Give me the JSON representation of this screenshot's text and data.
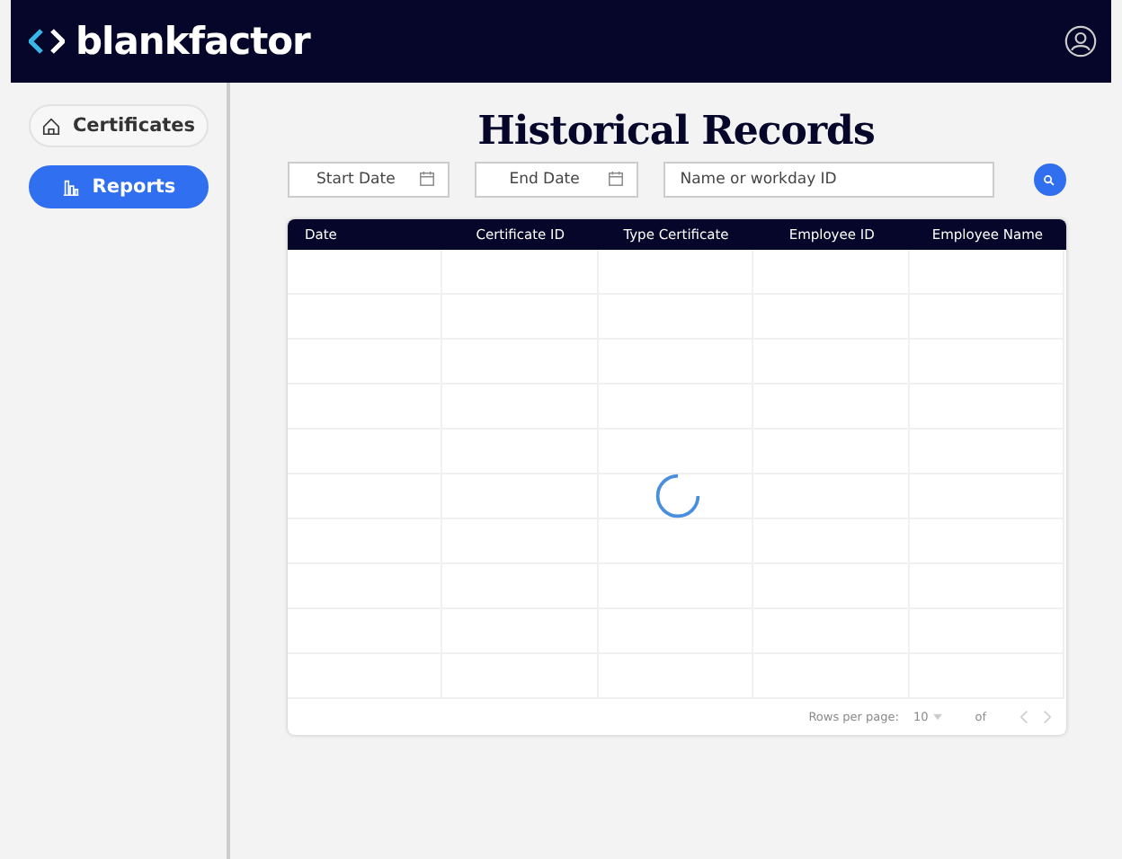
{
  "brand": {
    "name": "blankfactor"
  },
  "sidebar": {
    "items": [
      {
        "label": "Certificates",
        "selected": false
      },
      {
        "label": "Reports",
        "selected": true
      }
    ]
  },
  "page": {
    "title": "Historical Records"
  },
  "filters": {
    "start_date": {
      "placeholder": "Start Date"
    },
    "end_date": {
      "placeholder": "End Date"
    },
    "search": {
      "placeholder": "Name or workday ID"
    }
  },
  "table": {
    "columns": [
      "Date",
      "Certificate ID",
      "Type Certificate",
      "Employee ID",
      "Employee Name"
    ],
    "loading": true
  },
  "pagination": {
    "rows_label": "Rows per page:",
    "rows_value": "10",
    "of_label": "of"
  }
}
